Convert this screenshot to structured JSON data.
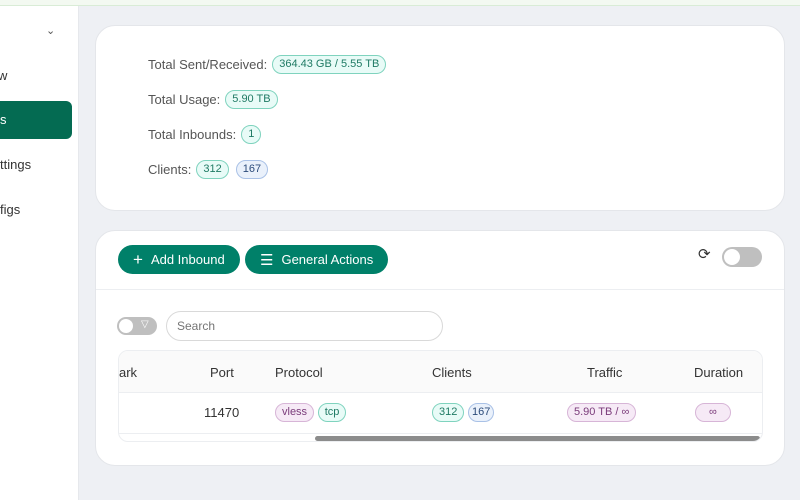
{
  "sidebar": {
    "items": [
      {
        "label": "w"
      },
      {
        "label": "s",
        "active": true
      },
      {
        "label": "ttings"
      },
      {
        "label": "figs"
      }
    ]
  },
  "stats": {
    "sent_received_label": "Total Sent/Received:",
    "sent_received_value": "364.43 GB / 5.55 TB",
    "usage_label": "Total Usage:",
    "usage_value": "5.90 TB",
    "inbounds_label": "Total Inbounds:",
    "inbounds_value": "1",
    "clients_label": "Clients:",
    "clients_total": "312",
    "clients_online": "167"
  },
  "toolbar": {
    "add_inbound": "Add Inbound",
    "general_actions": "General Actions"
  },
  "search": {
    "placeholder": "Search"
  },
  "table": {
    "headers": [
      "ark",
      "Port",
      "Protocol",
      "Clients",
      "Traffic",
      "Duration"
    ],
    "rows": [
      {
        "port": "11470",
        "protocol": "vless",
        "network": "tcp",
        "clients_total": "312",
        "clients_online": "167",
        "traffic": "5.90 TB / ∞",
        "duration": "∞"
      }
    ]
  },
  "colors": {
    "accent": "#008069",
    "sidebar_active": "#046b52"
  }
}
